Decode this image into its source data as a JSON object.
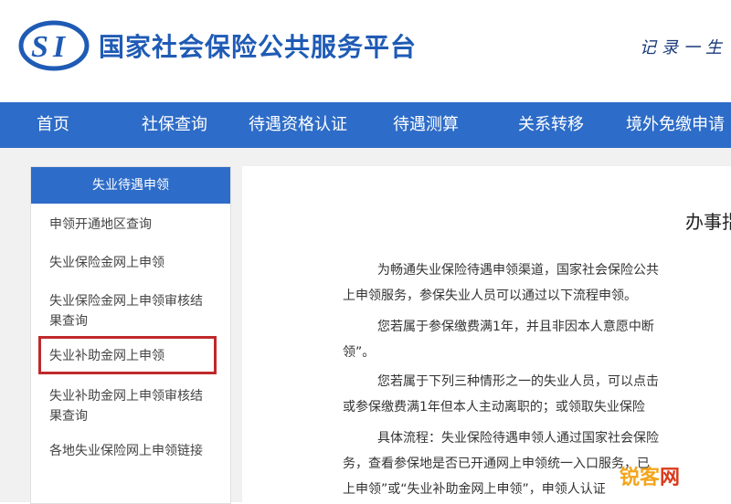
{
  "header": {
    "site_title": "国家社会保险公共服务平台",
    "slogan": "记录一生"
  },
  "nav": {
    "items": [
      "首页",
      "社保查询",
      "待遇资格认证",
      "待遇测算",
      "关系转移",
      "境外免缴申请"
    ]
  },
  "sidebar": {
    "header": "失业待遇申领",
    "items": [
      "申领开通地区查询",
      "失业保险金网上申领",
      "失业保险金网上申领审核结果查询",
      "失业补助金网上申领",
      "失业补助金网上申领审核结果查询",
      "各地失业保险网上申领链接"
    ]
  },
  "main": {
    "title": "办事指南",
    "lines": [
      "为畅通失业保险待遇申领渠道，国家社会保险公共",
      "上申领服务，参保失业人员可以通过以下流程申领。",
      "您若属于参保缴费满1年，并且非因本人意愿中断",
      "领”。",
      "您若属于下列三种情形之一的失业人员，可以点击",
      "或参保缴费满1年但本人主动离职的；或领取失业保险",
      "具体流程：失业保险待遇申领人通过国家社会保险",
      "务，查看参保地是否已开通网上申领统一入口服务，已",
      "上申领”或“失业补助金网上申领”，申领人认证"
    ]
  },
  "watermark": {
    "text_a": "锐客",
    "text_b": "网"
  },
  "colors": {
    "brand_blue": "#2d6cc8",
    "highlight_red": "#c0292b"
  }
}
